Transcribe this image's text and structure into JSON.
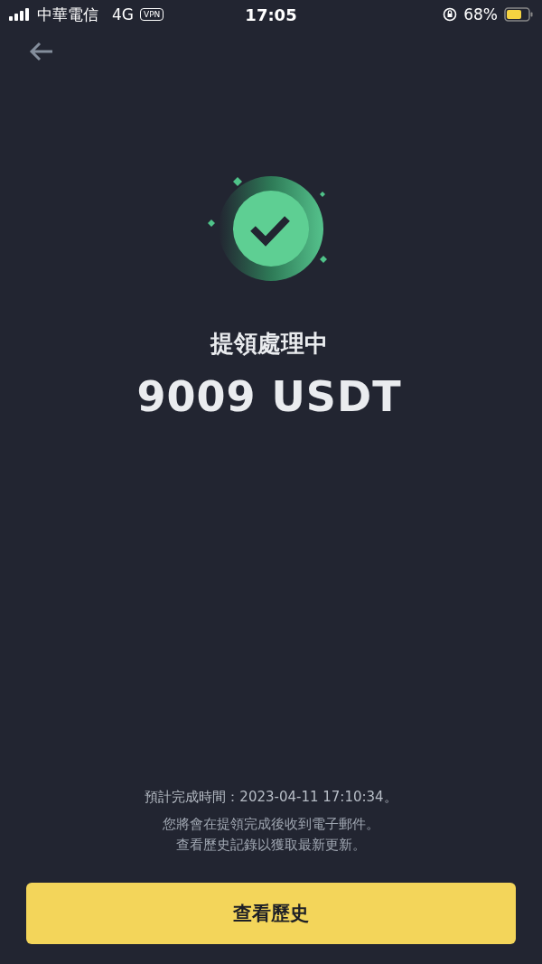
{
  "status_bar": {
    "carrier": "中華電信",
    "network": "4G",
    "vpn": "VPN",
    "time": "17:05",
    "battery_percent": "68%"
  },
  "result": {
    "title": "提領處理中",
    "amount": "9009 USDT"
  },
  "notes": [
    {
      "kind": "eta",
      "text": "預計完成時間：2023-04-11 17:10:34。"
    },
    {
      "kind": "info",
      "text": "您將會在提領完成後收到電子郵件。"
    },
    {
      "kind": "info",
      "text": "查看歷史記錄以獲取最新更新。"
    }
  ],
  "button": {
    "label": "查看歷史"
  }
}
